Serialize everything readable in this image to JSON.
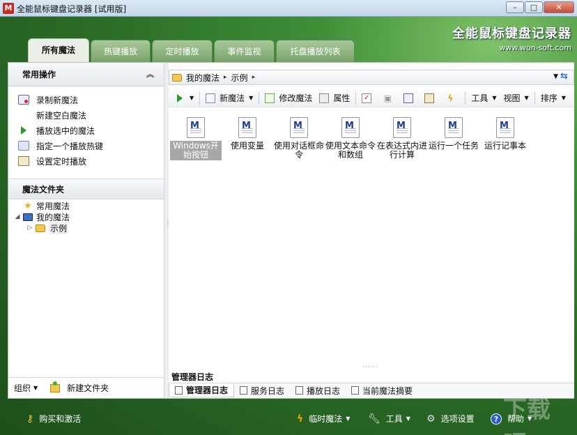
{
  "window": {
    "app_icon_letter": "M",
    "title": "全能鼠标键盘记录器 [试用版]",
    "minimize_symbol": "–",
    "maximize_symbol": "□",
    "close_symbol": "✕"
  },
  "brand": {
    "title": "全能鼠标键盘记录器",
    "url": "www.won-soft.com"
  },
  "tabs": [
    {
      "label": "所有魔法",
      "active": true
    },
    {
      "label": "热键播放",
      "active": false
    },
    {
      "label": "定时播放",
      "active": false
    },
    {
      "label": "事件监视",
      "active": false
    },
    {
      "label": "托盘播放列表",
      "active": false
    }
  ],
  "sidebar": {
    "common_ops_title": "常用操作",
    "collapse_symbol": "︽",
    "ops": [
      {
        "label": "录制新魔法",
        "icon": "record-icon"
      },
      {
        "label": "新建空白魔法",
        "icon": ""
      },
      {
        "label": "播放选中的魔法",
        "icon": "play-icon"
      },
      {
        "label": "指定一个播放热键",
        "icon": "keyboard-icon"
      },
      {
        "label": "设置定时播放",
        "icon": "schedule-icon"
      }
    ],
    "folders_title": "魔法文件夹",
    "tree": [
      {
        "label": "常用魔法",
        "icon": "star-icon",
        "arrow": ""
      },
      {
        "label": "我的魔法",
        "icon": "computer-icon",
        "arrow": "◢"
      },
      {
        "label": "示例",
        "icon": "folder-icon",
        "arrow": "▷"
      }
    ],
    "footer": {
      "organize_label": "组织",
      "new_folder_label": "新建文件夹"
    }
  },
  "address": {
    "crumbs": [
      "我的魔法",
      "示例"
    ],
    "sep": "▸",
    "dropdown": "▼",
    "refresh": "⇆"
  },
  "toolbar": {
    "new_label": "新魔法",
    "edit_label": "修改魔法",
    "props_label": "属性",
    "tools_label": "工具",
    "view_label": "视图",
    "sort_label": "排序"
  },
  "files": [
    {
      "label": "Windows开始按钮",
      "selected": true
    },
    {
      "label": "使用变量",
      "selected": false
    },
    {
      "label": "使用对话框命令",
      "selected": false
    },
    {
      "label": "使用文本命令和数组",
      "selected": false
    },
    {
      "label": "在表达式内进行计算",
      "selected": false
    },
    {
      "label": "运行一个任务",
      "selected": false
    },
    {
      "label": "运行记事本",
      "selected": false
    }
  ],
  "log": {
    "title": "管理器日志",
    "tabs": [
      {
        "label": "管理器日志",
        "active": true
      },
      {
        "label": "服务日志",
        "active": false
      },
      {
        "label": "播放日志",
        "active": false
      },
      {
        "label": "当前魔法摘要",
        "active": false
      }
    ]
  },
  "bottom": {
    "buy_label": "购买和激活",
    "temp_magic_label": "临时魔法",
    "tools_label": "工具",
    "options_label": "选项设置",
    "help_label": "帮助"
  },
  "watermark_text": "下载吧"
}
